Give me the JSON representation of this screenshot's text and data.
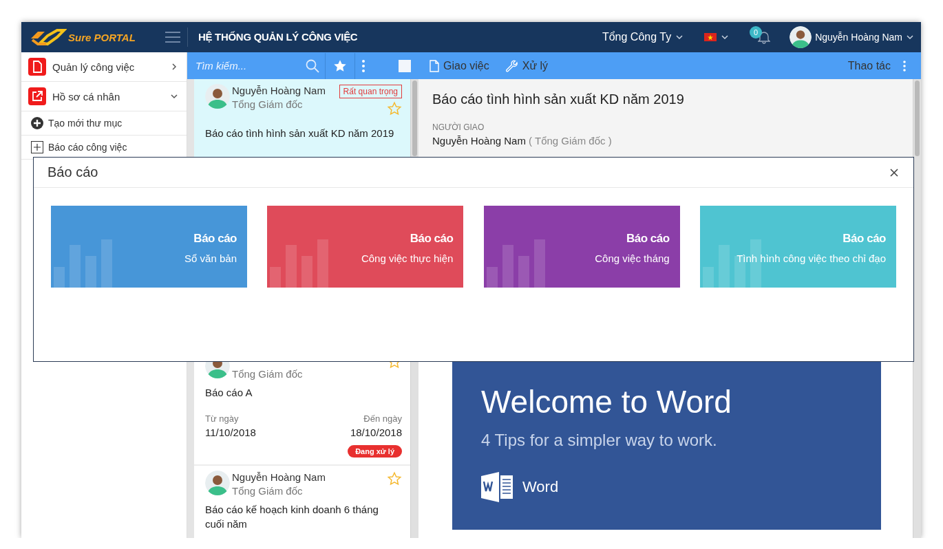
{
  "header": {
    "logo": "Sure PORTAL",
    "title": "HỆ THỐNG QUẢN LÝ CÔNG VIỆC",
    "organization": "Tổng Công Ty",
    "notifications": "0",
    "user": "Nguyễn Hoàng Nam"
  },
  "sidebar": {
    "items": [
      {
        "label": "Quản lý công việc",
        "kind": "menu",
        "expanded": false
      },
      {
        "label": "Hồ sơ cá nhân",
        "kind": "profile",
        "expanded": true
      },
      {
        "label": "Tạo mới thư mục",
        "kind": "action"
      },
      {
        "label": "Báo cáo công việc",
        "kind": "folder"
      }
    ]
  },
  "list": {
    "search": {
      "placeholder": "Tìm kiếm..."
    },
    "select_all": {
      "checked": false
    },
    "cards": [
      {
        "name": "Nguyễn Hoàng Nam",
        "position": "Tổng Giám đốc",
        "priority": "Rất quan trọng",
        "subject": "Báo cáo tình hình sản xuất KD năm 2019",
        "starred": false,
        "selected": true
      },
      {
        "position": "Tổng Giám đốc",
        "subject": "Báo cáo A",
        "from_label": "Từ ngày",
        "from_date": "11/10/2018",
        "to_label": "Đến ngày",
        "to_date": "18/10/2018",
        "status": "Đang xử lý",
        "starred": false,
        "selected": false
      },
      {
        "name": "Nguyễn Hoàng Nam",
        "position": "Tổng Giám đốc",
        "subject": "Báo cáo kế hoạch kinh doanh 6 tháng cuối năm",
        "starred": false,
        "selected": false
      }
    ]
  },
  "detail": {
    "toolbar": [
      {
        "label": "Giao việc",
        "kind": "document"
      },
      {
        "label": "Xử lý",
        "kind": "tool"
      }
    ],
    "actions_label": "Thao tác",
    "title": "Báo cáo tình hình sản xuất KD năm 2019",
    "assigner_label": "NGƯỜI GIAO",
    "assigner": "Nguyễn Hoàng Nam",
    "assigner_role": "( Tổng Giám đốc )",
    "document": {
      "heading": "Welcome to Word",
      "subheading": "4 Tips for a simpler way to work.",
      "app_name": "Word"
    }
  },
  "modal": {
    "title": "Báo cáo",
    "tiles": [
      {
        "title": "Báo cáo",
        "subtitle": "Sổ văn bản",
        "color": "#4796d8"
      },
      {
        "title": "Báo cáo",
        "subtitle": "Công việc thực hiện",
        "color": "#df4b5a"
      },
      {
        "title": "Báo cáo",
        "subtitle": "Công việc tháng",
        "color": "#8b3ea8"
      },
      {
        "title": "Báo cáo",
        "subtitle": "Tình hình công việc theo chỉ đạo",
        "color": "#4fc4d1"
      }
    ]
  }
}
